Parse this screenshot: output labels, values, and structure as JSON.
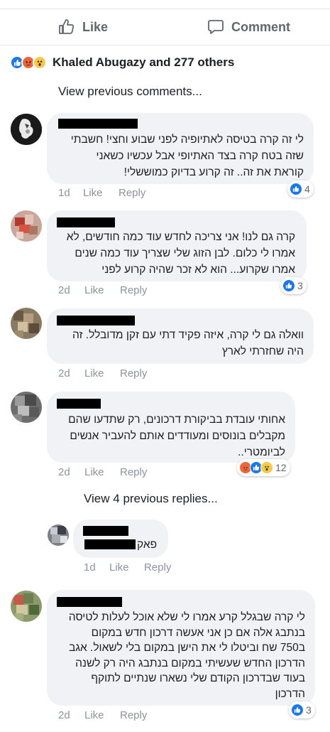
{
  "actions": {
    "like_label": "Like",
    "comment_label": "Comment"
  },
  "reactions_summary": {
    "text": "Khaled Abugazy and 277 others",
    "icons": [
      "like-icon",
      "angry-icon",
      "wow-icon"
    ]
  },
  "view_previous_comments": "View previous comments...",
  "comments": [
    {
      "lines": [
        "לי זה קרה בטיסה לאתיופיה לפני שבוע וחצי! חשבתי",
        "שזה בטח קרה בצד האתיופי אבל עכשיו כשאני",
        "קוראת את זה.. זה קרוע בדיוק כמוששלי!"
      ],
      "time": "1d",
      "like": "Like",
      "reply": "Reply",
      "reaction_count": "4"
    },
    {
      "lines": [
        "קרה גם לנו! אני צריכה לחדש עוד כמה חודשים, לא",
        "אמרו לי כלום. לבן הזוג שלי שצריך עוד כמה שנים",
        "אמרו שקרוע... הוא לא זכר שהיה קרוע לפני"
      ],
      "time": "2d",
      "like": "Like",
      "reply": "Reply",
      "reaction_count": "3"
    },
    {
      "lines": [
        "וואלה גם לי קרה, איזה פקיד דתי עם זקן מדובלל. זה",
        "היה שחזרתי לארץ"
      ],
      "time": "2d",
      "like": "Like",
      "reply": "Reply"
    },
    {
      "lines": [
        "אחותי עובדת בביקורת דרכונים, רק שתדעו שהם",
        "מקבלים בונוסים ומעודדים אותם להעביר אנשים",
        "לביומטרי.."
      ],
      "time": "2d",
      "like": "Like",
      "reply": "Reply",
      "reaction_count": "12"
    },
    {
      "lines": [
        "לי קרה שבגלל קרע אמרו לי שלא אוכל לעלות לטיסה",
        "בנתבג אלה אם כן אני אעשה דרכון חדש במקום",
        "ב750 שח וביטלו לי את הישן במקום בלי לשאול. אגב",
        "הדרכון החדש שעשיתי במקום בנתבג היה רק לשנה",
        "בעוד שבדרכון הקודם שלי נשארו שנתיים לתוקף",
        "הדרכון"
      ],
      "time": "2d",
      "like": "Like",
      "reply": "Reply",
      "reaction_count": "3"
    }
  ],
  "view_replies": "View 4 previous replies...",
  "reply": {
    "text": "פאק",
    "time": "1d",
    "like": "Like",
    "reply": "Reply"
  },
  "colors": {
    "like_blue": "#1877f2",
    "angry": "#f0643a",
    "wow": "#f7c948",
    "muted": "#8d949e",
    "bubble": "#f0f2f5"
  }
}
